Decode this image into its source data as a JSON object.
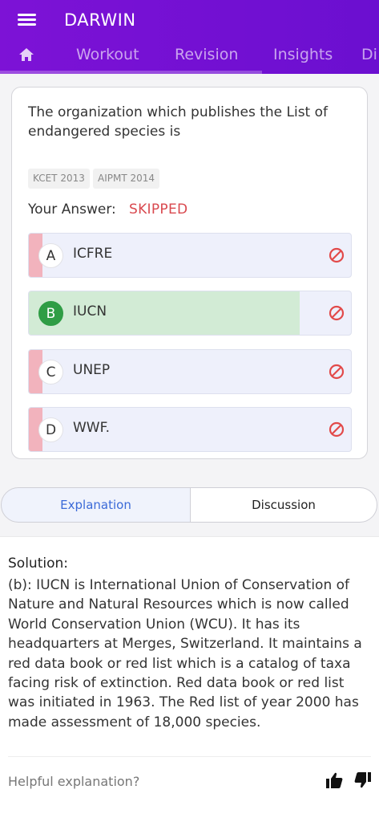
{
  "header": {
    "app_title": "DARWIN",
    "tabs": [
      "Workout",
      "Revision",
      "Insights",
      "Di"
    ]
  },
  "question": {
    "text": "The organization which publishes the List of endangered species is",
    "tags": [
      "KCET 2013",
      "AIPMT 2014"
    ],
    "answer_label": "Your Answer:",
    "answer_value": "SKIPPED",
    "options": [
      {
        "letter": "A",
        "text": "ICFRE"
      },
      {
        "letter": "B",
        "text": "IUCN"
      },
      {
        "letter": "C",
        "text": "UNEP"
      },
      {
        "letter": "D",
        "text": "WWF."
      }
    ]
  },
  "explanation_tabs": {
    "explanation": "Explanation",
    "discussion": "Discussion"
  },
  "solution": {
    "title": "Solution:",
    "text": "(b): IUCN is International Union of Conservation of Nature and Natural Resources which is now called World Conservation Union (WCU). It has its headquarters at Merges, Switzerland. It maintains a red data book or red list which is a catalog of taxa facing risk of extinction. Red data book or red list was initiated in 1963. The Red list of year 2000 has made assessment of 18,000 species."
  },
  "feedback": {
    "prompt": "Helpful explanation?"
  },
  "colors": {
    "header": "#7d12d6",
    "correct": "#2f9d45",
    "wrong": "#f2b3bd",
    "skipped": "#d9494f"
  }
}
